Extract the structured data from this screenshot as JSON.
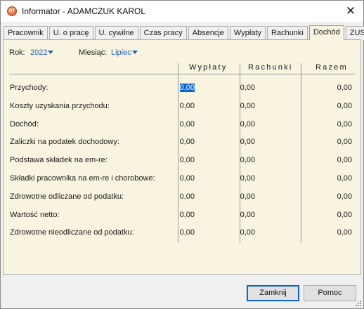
{
  "window": {
    "title": "Informator - ADAMCZUK KAROL",
    "close_glyph": "✕",
    "app_icon": "app-logo-icon"
  },
  "tabs": [
    {
      "label": "Pracownik",
      "active": false
    },
    {
      "label": "U. o pracę",
      "active": false
    },
    {
      "label": "U. cywilne",
      "active": false
    },
    {
      "label": "Czas pracy",
      "active": false
    },
    {
      "label": "Absencje",
      "active": false
    },
    {
      "label": "Wypłaty",
      "active": false
    },
    {
      "label": "Rachunki",
      "active": false
    },
    {
      "label": "Dochód",
      "active": true
    },
    {
      "label": "ZUS",
      "active": false
    }
  ],
  "filters": {
    "year_label": "Rok:",
    "year_value": "2022",
    "month_label": "Miesiąc:",
    "month_value": "Lipiec"
  },
  "columns": [
    "Wypłaty",
    "Rachunki",
    "Razem"
  ],
  "rows": [
    {
      "label": "Przychody:",
      "values": [
        "0,00",
        "0,00",
        "0,00"
      ]
    },
    {
      "label": "Koszty uzyskania przychodu:",
      "values": [
        "0,00",
        "0,00",
        "0,00"
      ]
    },
    {
      "label": "Dochód:",
      "values": [
        "0,00",
        "0,00",
        "0,00"
      ]
    },
    {
      "label": "Zaliczki na podatek dochodowy:",
      "values": [
        "0,00",
        "0,00",
        "0,00"
      ]
    },
    {
      "label": "Podstawa składek na em-re:",
      "values": [
        "0,00",
        "0,00",
        "0,00"
      ]
    },
    {
      "label": "Składki pracownika na em-re i chorobowe:",
      "values": [
        "0,00",
        "0,00",
        "0,00"
      ]
    },
    {
      "label": "Zdrowotne odliczane od podatku:",
      "values": [
        "0,00",
        "0,00",
        "0,00"
      ]
    },
    {
      "label": "Wartość netto:",
      "values": [
        "0,00",
        "0,00",
        "0,00"
      ]
    },
    {
      "label": "Zdrowotne nieodliczane od podatku:",
      "values": [
        "0,00",
        "0,00",
        "0,00"
      ]
    }
  ],
  "selected_cell": {
    "row": 0,
    "col": 0
  },
  "buttons": {
    "ok_label": "Zamknij",
    "help_label": "Pomoc"
  },
  "colors": {
    "panel_bg": "#f8f4e0",
    "link": "#1f5fbf",
    "selection": "#0a64d8"
  }
}
